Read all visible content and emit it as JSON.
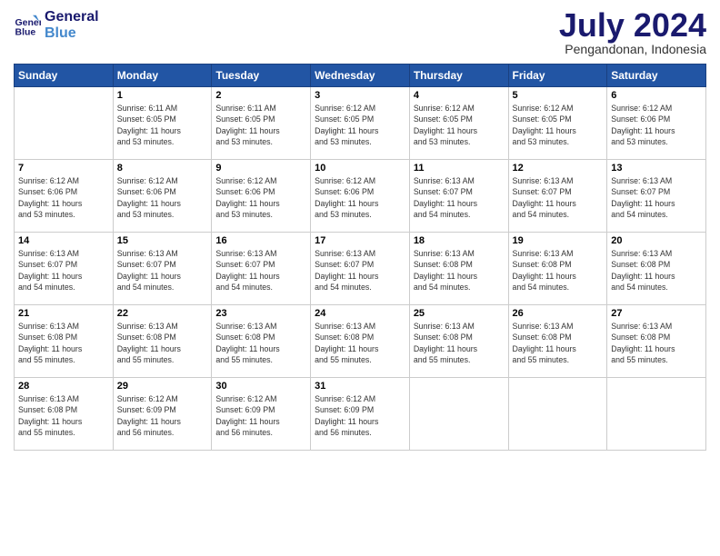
{
  "logo": {
    "line1": "General",
    "line2": "Blue"
  },
  "title": "July 2024",
  "subtitle": "Pengandonan, Indonesia",
  "days_of_week": [
    "Sunday",
    "Monday",
    "Tuesday",
    "Wednesday",
    "Thursday",
    "Friday",
    "Saturday"
  ],
  "weeks": [
    [
      {
        "day": "",
        "info": ""
      },
      {
        "day": "1",
        "info": "Sunrise: 6:11 AM\nSunset: 6:05 PM\nDaylight: 11 hours\nand 53 minutes."
      },
      {
        "day": "2",
        "info": "Sunrise: 6:11 AM\nSunset: 6:05 PM\nDaylight: 11 hours\nand 53 minutes."
      },
      {
        "day": "3",
        "info": "Sunrise: 6:12 AM\nSunset: 6:05 PM\nDaylight: 11 hours\nand 53 minutes."
      },
      {
        "day": "4",
        "info": "Sunrise: 6:12 AM\nSunset: 6:05 PM\nDaylight: 11 hours\nand 53 minutes."
      },
      {
        "day": "5",
        "info": "Sunrise: 6:12 AM\nSunset: 6:05 PM\nDaylight: 11 hours\nand 53 minutes."
      },
      {
        "day": "6",
        "info": "Sunrise: 6:12 AM\nSunset: 6:06 PM\nDaylight: 11 hours\nand 53 minutes."
      }
    ],
    [
      {
        "day": "7",
        "info": "Sunrise: 6:12 AM\nSunset: 6:06 PM\nDaylight: 11 hours\nand 53 minutes."
      },
      {
        "day": "8",
        "info": "Sunrise: 6:12 AM\nSunset: 6:06 PM\nDaylight: 11 hours\nand 53 minutes."
      },
      {
        "day": "9",
        "info": "Sunrise: 6:12 AM\nSunset: 6:06 PM\nDaylight: 11 hours\nand 53 minutes."
      },
      {
        "day": "10",
        "info": "Sunrise: 6:12 AM\nSunset: 6:06 PM\nDaylight: 11 hours\nand 53 minutes."
      },
      {
        "day": "11",
        "info": "Sunrise: 6:13 AM\nSunset: 6:07 PM\nDaylight: 11 hours\nand 54 minutes."
      },
      {
        "day": "12",
        "info": "Sunrise: 6:13 AM\nSunset: 6:07 PM\nDaylight: 11 hours\nand 54 minutes."
      },
      {
        "day": "13",
        "info": "Sunrise: 6:13 AM\nSunset: 6:07 PM\nDaylight: 11 hours\nand 54 minutes."
      }
    ],
    [
      {
        "day": "14",
        "info": "Sunrise: 6:13 AM\nSunset: 6:07 PM\nDaylight: 11 hours\nand 54 minutes."
      },
      {
        "day": "15",
        "info": "Sunrise: 6:13 AM\nSunset: 6:07 PM\nDaylight: 11 hours\nand 54 minutes."
      },
      {
        "day": "16",
        "info": "Sunrise: 6:13 AM\nSunset: 6:07 PM\nDaylight: 11 hours\nand 54 minutes."
      },
      {
        "day": "17",
        "info": "Sunrise: 6:13 AM\nSunset: 6:07 PM\nDaylight: 11 hours\nand 54 minutes."
      },
      {
        "day": "18",
        "info": "Sunrise: 6:13 AM\nSunset: 6:08 PM\nDaylight: 11 hours\nand 54 minutes."
      },
      {
        "day": "19",
        "info": "Sunrise: 6:13 AM\nSunset: 6:08 PM\nDaylight: 11 hours\nand 54 minutes."
      },
      {
        "day": "20",
        "info": "Sunrise: 6:13 AM\nSunset: 6:08 PM\nDaylight: 11 hours\nand 54 minutes."
      }
    ],
    [
      {
        "day": "21",
        "info": "Sunrise: 6:13 AM\nSunset: 6:08 PM\nDaylight: 11 hours\nand 55 minutes."
      },
      {
        "day": "22",
        "info": "Sunrise: 6:13 AM\nSunset: 6:08 PM\nDaylight: 11 hours\nand 55 minutes."
      },
      {
        "day": "23",
        "info": "Sunrise: 6:13 AM\nSunset: 6:08 PM\nDaylight: 11 hours\nand 55 minutes."
      },
      {
        "day": "24",
        "info": "Sunrise: 6:13 AM\nSunset: 6:08 PM\nDaylight: 11 hours\nand 55 minutes."
      },
      {
        "day": "25",
        "info": "Sunrise: 6:13 AM\nSunset: 6:08 PM\nDaylight: 11 hours\nand 55 minutes."
      },
      {
        "day": "26",
        "info": "Sunrise: 6:13 AM\nSunset: 6:08 PM\nDaylight: 11 hours\nand 55 minutes."
      },
      {
        "day": "27",
        "info": "Sunrise: 6:13 AM\nSunset: 6:08 PM\nDaylight: 11 hours\nand 55 minutes."
      }
    ],
    [
      {
        "day": "28",
        "info": "Sunrise: 6:13 AM\nSunset: 6:08 PM\nDaylight: 11 hours\nand 55 minutes."
      },
      {
        "day": "29",
        "info": "Sunrise: 6:12 AM\nSunset: 6:09 PM\nDaylight: 11 hours\nand 56 minutes."
      },
      {
        "day": "30",
        "info": "Sunrise: 6:12 AM\nSunset: 6:09 PM\nDaylight: 11 hours\nand 56 minutes."
      },
      {
        "day": "31",
        "info": "Sunrise: 6:12 AM\nSunset: 6:09 PM\nDaylight: 11 hours\nand 56 minutes."
      },
      {
        "day": "",
        "info": ""
      },
      {
        "day": "",
        "info": ""
      },
      {
        "day": "",
        "info": ""
      }
    ]
  ]
}
